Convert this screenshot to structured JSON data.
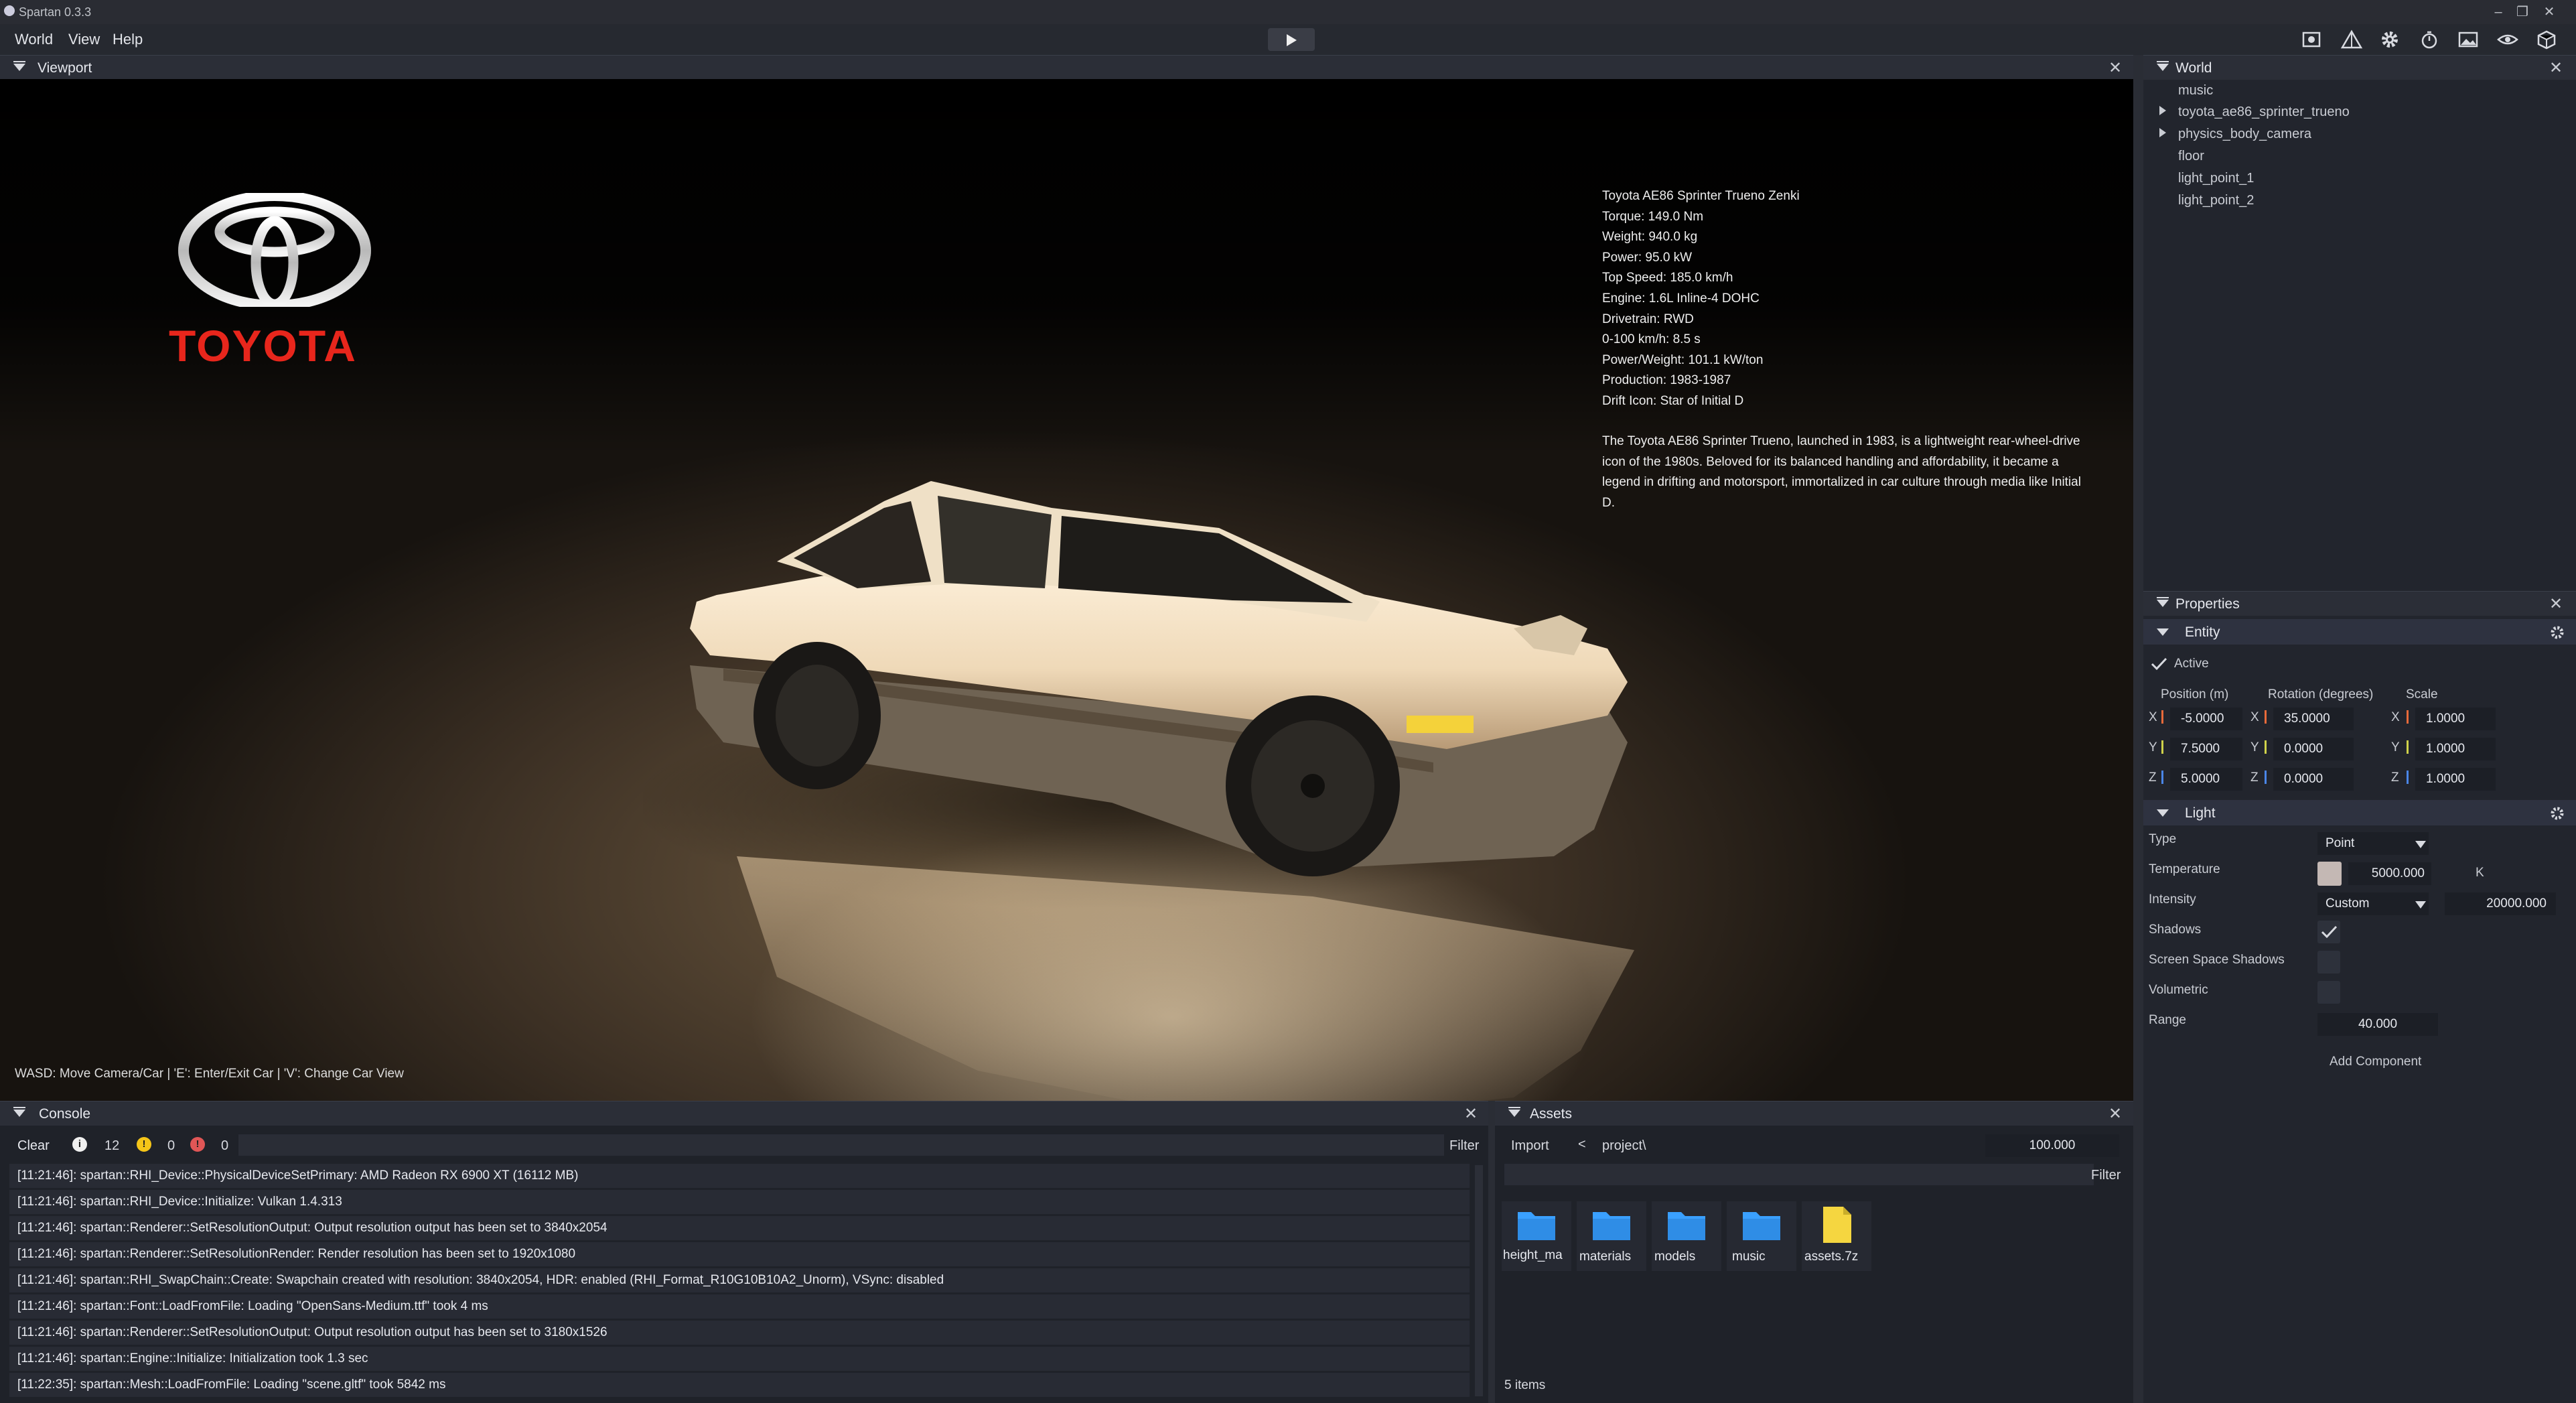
{
  "app": {
    "title": "Spartan 0.3.3"
  },
  "menu": {
    "items": [
      "World",
      "View",
      "Help"
    ]
  },
  "toolbar": {
    "icons": [
      "screenshot-icon",
      "prism-icon",
      "gear-icon",
      "timer-icon",
      "image-icon",
      "eye-icon",
      "cube-icon"
    ]
  },
  "viewport": {
    "title": "Viewport",
    "logo_text": "TOYOTA",
    "car_info": [
      "Toyota AE86 Sprinter Trueno Zenki",
      "Torque: 149.0 Nm",
      "Weight: 940.0 kg",
      "Power: 95.0 kW",
      "Top Speed: 185.0 km/h",
      "Engine: 1.6L Inline-4 DOHC",
      "Drivetrain: RWD",
      "0-100 km/h: 8.5 s",
      "Power/Weight: 101.1 kW/ton",
      "Production: 1983-1987",
      "Drift Icon: Star of Initial D"
    ],
    "description": "The Toyota AE86 Sprinter Trueno, launched in 1983, is a lightweight rear-wheel-drive icon of the 1980s. Beloved for its balanced handling and affordability, it became a legend in drifting and motorsport, immortalized in car culture through media like Initial D.",
    "help": "WASD: Move Camera/Car | 'E': Enter/Exit Car | 'V': Change Car View"
  },
  "world": {
    "title": "World",
    "items": [
      {
        "label": "music",
        "expandable": false
      },
      {
        "label": "toyota_ae86_sprinter_trueno",
        "expandable": true
      },
      {
        "label": "physics_body_camera",
        "expandable": true
      },
      {
        "label": "floor",
        "expandable": false
      },
      {
        "label": "light_point_1",
        "expandable": false
      },
      {
        "label": "light_point_2",
        "expandable": false
      }
    ]
  },
  "properties": {
    "title": "Properties",
    "entity": {
      "title": "Entity",
      "active_label": "Active",
      "position_label": "Position (m)",
      "rotation_label": "Rotation (degrees)",
      "scale_label": "Scale",
      "axes": [
        "X",
        "Y",
        "Z"
      ],
      "position": [
        "-5.0000",
        "7.5000",
        "5.0000"
      ],
      "rotation": [
        "35.0000",
        "0.0000",
        "0.0000"
      ],
      "scale": [
        "1.0000",
        "1.0000",
        "1.0000"
      ]
    },
    "light": {
      "title": "Light",
      "type_label": "Type",
      "type_value": "Point",
      "temperature_label": "Temperature",
      "temperature_value": "5000.000",
      "temperature_unit": "K",
      "intensity_label": "Intensity",
      "intensity_preset": "Custom",
      "intensity_value": "20000.000",
      "shadows_label": "Shadows",
      "shadows_checked": true,
      "ss_shadows_label": "Screen Space Shadows",
      "volumetric_label": "Volumetric",
      "range_label": "Range",
      "range_value": "40.000"
    },
    "add_component": "Add Component"
  },
  "console": {
    "title": "Console",
    "clear_label": "Clear",
    "info_count": "12",
    "warning_count": "0",
    "error_count": "0",
    "filter_label": "Filter",
    "lines": [
      "[11:21:46]: spartan::RHI_Device::PhysicalDeviceSetPrimary: AMD Radeon RX 6900 XT (16112 MB)",
      "[11:21:46]: spartan::RHI_Device::Initialize: Vulkan 1.4.313",
      "[11:21:46]: spartan::Renderer::SetResolutionOutput: Output resolution output has been set to 3840x2054",
      "[11:21:46]: spartan::Renderer::SetResolutionRender: Render resolution has been set to 1920x1080",
      "[11:21:46]: spartan::RHI_SwapChain::Create: Swapchain created with resolution: 3840x2054, HDR: enabled (RHI_Format_R10G10B10A2_Unorm), VSync: disabled",
      "[11:21:46]: spartan::Font::LoadFromFile: Loading \"OpenSans-Medium.ttf\" took 4 ms",
      "[11:21:46]: spartan::Renderer::SetResolutionOutput: Output resolution output has been set to 3180x1526",
      "[11:21:46]: spartan::Engine::Initialize: Initialization took 1.3 sec",
      "[11:22:35]: spartan::Mesh::LoadFromFile: Loading \"scene.gltf\" took 5842 ms"
    ]
  },
  "assets": {
    "title": "Assets",
    "import_label": "Import",
    "back_label": "<",
    "path": "project\\",
    "zoom_value": "100.000",
    "filter_label": "Filter",
    "items": [
      "height_ma",
      "materials",
      "models",
      "music",
      "assets.7z"
    ],
    "count_label": "5 items"
  },
  "colors": {
    "accent_blue": "#3d8ff0",
    "folder_blue": "#3aa0ff",
    "archive_yellow": "#f5d640",
    "logo_red": "#e8261c"
  }
}
